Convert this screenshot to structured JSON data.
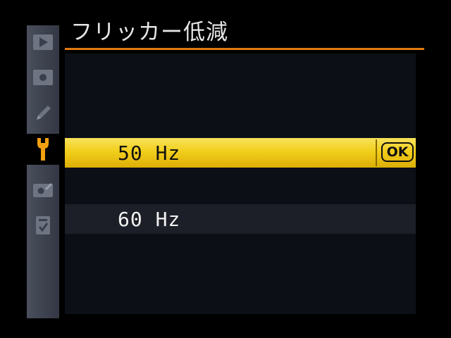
{
  "title": "フリッカー低減",
  "sidebar": {
    "items": [
      {
        "icon": "playback-icon",
        "active": false
      },
      {
        "icon": "shooting-icon",
        "active": false
      },
      {
        "icon": "custom-settings-pencil-icon",
        "active": false
      },
      {
        "icon": "setup-wrench-icon",
        "active": true
      },
      {
        "icon": "retouch-icon",
        "active": false
      },
      {
        "icon": "my-menu-icon",
        "active": false
      }
    ]
  },
  "options": [
    {
      "label": "50 Hz",
      "selected": true,
      "confirm": "OK"
    },
    {
      "label": "60 Hz",
      "selected": false
    }
  ],
  "colors": {
    "accent_rule": "#e07a10",
    "selected_bar": "#f2cf1c",
    "active_icon": "#f0a010",
    "background": "#000000"
  }
}
